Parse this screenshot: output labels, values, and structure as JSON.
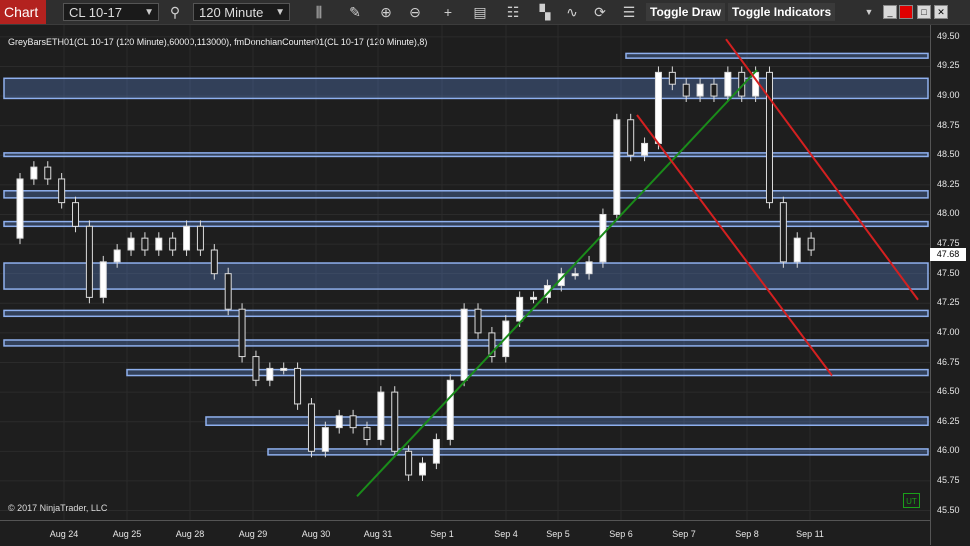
{
  "toolbar": {
    "chart_label": "Chart",
    "instrument": "CL 10-17",
    "interval": "120 Minute",
    "toggle_draw": "Toggle Draw",
    "toggle_indicators": "Toggle Indicators",
    "colors": {
      "chart_label_bg": "#b3221f",
      "restore": "#e00000"
    }
  },
  "chart": {
    "indicator_label": "GreyBarsETH01(CL 10-17 (120 Minute),60000,113000), fmDonchianCounter01(CL 10-17 (120 Minute),8)",
    "copyright": "© 2017 NinjaTrader, LLC",
    "status_badge": "UT",
    "last_price": "47.68",
    "y_ticks": [
      "49.50",
      "49.25",
      "49.00",
      "48.75",
      "48.50",
      "48.25",
      "48.00",
      "47.75",
      "47.50",
      "47.25",
      "47.00",
      "46.75",
      "46.50",
      "46.25",
      "46.00",
      "45.75",
      "45.50"
    ],
    "x_ticks": [
      "Aug 24",
      "Aug 25",
      "Aug 28",
      "Aug 29",
      "Aug 30",
      "Aug 31",
      "Sep 1",
      "Sep 4",
      "Sep 5",
      "Sep 6",
      "Sep 7",
      "Sep 8",
      "Sep 11"
    ]
  },
  "chart_data": {
    "type": "candlestick",
    "ylim": [
      45.42,
      49.6
    ],
    "zones": [
      {
        "from": 49.32,
        "to": 49.36
      },
      {
        "from": 48.98,
        "to": 49.15
      },
      {
        "from": 48.49,
        "to": 48.52
      },
      {
        "from": 48.14,
        "to": 48.2
      },
      {
        "from": 47.9,
        "to": 47.94
      },
      {
        "from": 47.37,
        "to": 47.59
      },
      {
        "from": 47.14,
        "to": 47.19
      },
      {
        "from": 46.89,
        "to": 46.94
      },
      {
        "from": 46.64,
        "to": 46.69
      },
      {
        "from": 46.22,
        "to": 46.29
      },
      {
        "from": 45.97,
        "to": 46.02
      }
    ],
    "trendlines": [
      {
        "color": "#1a8c1a",
        "from": [
          "Aug 30",
          45.62
        ],
        "to": [
          "Sep 8",
          49.22
        ]
      },
      {
        "color": "#d42020",
        "from": [
          "Sep 6",
          48.84
        ],
        "to": [
          "Sep 11",
          46.64
        ]
      },
      {
        "color": "#d42020",
        "from": [
          "Sep 7",
          49.48
        ],
        "to": [
          "Sep 11",
          47.28
        ]
      }
    ],
    "price_path": [
      47.8,
      48.3,
      48.4,
      48.3,
      48.1,
      47.9,
      47.3,
      47.6,
      47.7,
      47.8,
      47.7,
      47.8,
      47.7,
      47.9,
      47.7,
      47.5,
      47.2,
      46.8,
      46.6,
      46.7,
      46.7,
      46.4,
      46.0,
      46.2,
      46.3,
      46.2,
      46.1,
      46.5,
      46.0,
      45.8,
      45.9,
      46.1,
      46.6,
      47.2,
      47.0,
      46.8,
      47.1,
      47.3,
      47.3,
      47.4,
      47.5,
      47.5,
      47.6,
      48.0,
      48.8,
      48.5,
      48.6,
      49.2,
      49.1,
      49.0,
      49.1,
      49.0,
      49.2,
      49.0,
      49.2,
      48.1,
      47.6,
      47.8,
      47.7
    ]
  }
}
